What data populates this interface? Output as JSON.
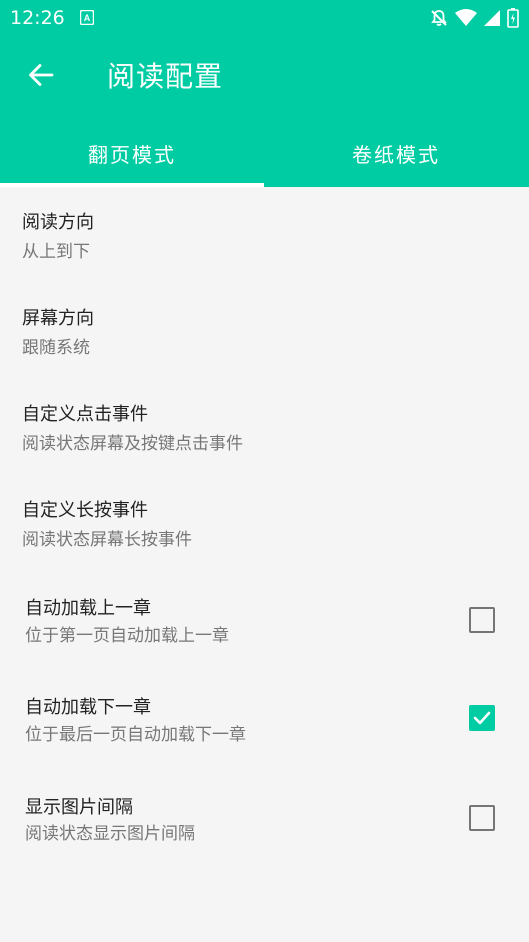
{
  "status_bar": {
    "time": "12:26",
    "icons": [
      "text-notification-icon",
      "bell-off-icon",
      "wifi-icon",
      "signal-icon",
      "battery-icon"
    ]
  },
  "app_bar": {
    "title": "阅读配置",
    "back_icon": "arrow-back-icon"
  },
  "tabs": [
    {
      "label": "翻页模式",
      "selected": true
    },
    {
      "label": "卷纸模式",
      "selected": false
    }
  ],
  "settings": [
    {
      "title": "阅读方向",
      "summary": "从上到下"
    },
    {
      "title": "屏幕方向",
      "summary": "跟随系统"
    },
    {
      "title": "自定义点击事件",
      "summary": "阅读状态屏幕及按键点击事件"
    },
    {
      "title": "自定义长按事件",
      "summary": "阅读状态屏幕长按事件"
    },
    {
      "title": "自动加载上一章",
      "summary": "位于第一页自动加载上一章",
      "checked": false
    },
    {
      "title": "自动加载下一章",
      "summary": "位于最后一页自动加载下一章",
      "checked": true
    },
    {
      "title": "显示图片间隔",
      "summary": "阅读状态显示图片间隔",
      "checked": false
    }
  ],
  "colors": {
    "accent": "#00cca3",
    "background": "#f5f5f5",
    "title_text": "#222222",
    "summary_text": "#777777"
  }
}
